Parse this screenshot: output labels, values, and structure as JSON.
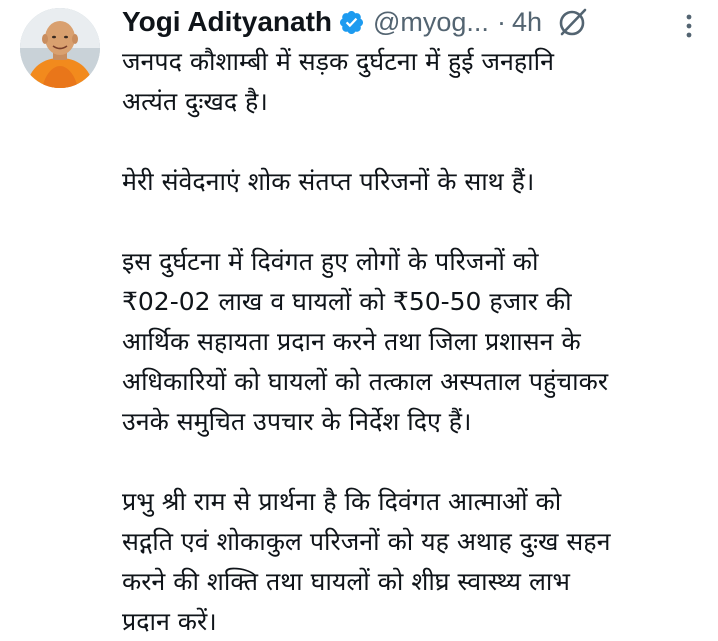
{
  "tweet": {
    "author_name": "Yogi Adityanath",
    "handle": "@myog...",
    "separator": "·",
    "time": "4h",
    "paragraphs": [
      "जनपद कौशाम्बी में सड़क दुर्घटना में हुई जनहानि\nअत्यंत दुःखद है।",
      "मेरी संवेदनाएं शोक संतप्त परिजनों के साथ हैं।",
      "इस दुर्घटना में दिवंगत हुए लोगों के परिजनों को\n₹02-02 लाख व घायलों को ₹50-50 हजार की\nआर्थिक सहायता प्रदान करने तथा जिला प्रशासन के\nअधिकारियों को घायलों को तत्काल अस्पताल पहुंचाकर\nउनके समुचित उपचार के निर्देश दिए हैं।",
      "प्रभु श्री राम से प्रार्थना है कि दिवंगत आत्माओं को\nसद्गति एवं शोकाकुल परिजनों को यह अथाह दुःख सहन\nकरने की शक्ति तथा घायलों को शीघ्र स्वास्थ्य लाभ\nप्रदान करें।"
    ]
  },
  "icons": {
    "verified": "verified-badge-icon",
    "grok": "grok-icon",
    "more": "more-options-icon"
  },
  "colors": {
    "verified_blue": "#1d9bf0",
    "secondary_text": "#536471",
    "primary_text": "#0f1419"
  }
}
